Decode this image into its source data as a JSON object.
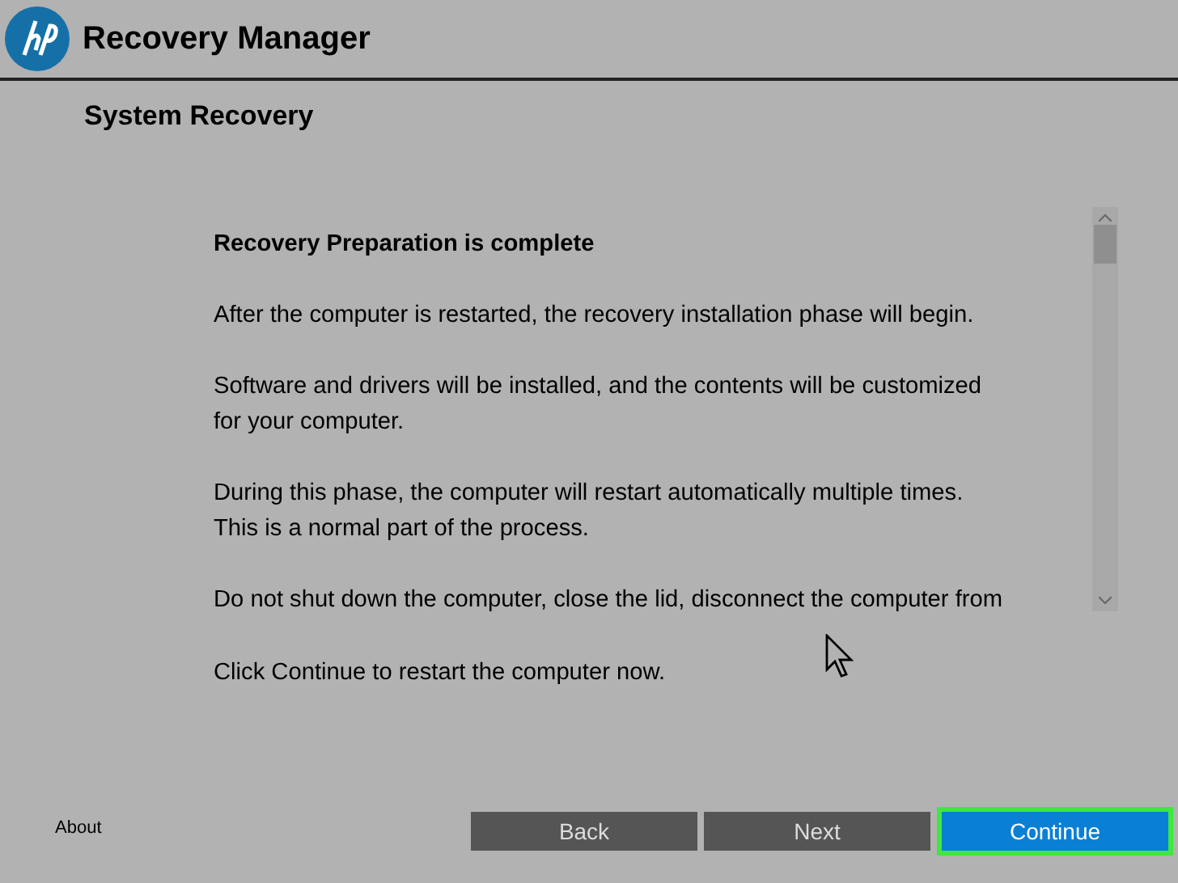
{
  "window": {
    "title": "Recovery Manager"
  },
  "section_title": "System Recovery",
  "message": {
    "heading": "Recovery Preparation is complete",
    "paragraphs": [
      "After the computer is restarted, the recovery installation phase will begin.",
      "Software and drivers will be installed, and the contents will be customized\nfor your computer.",
      "During this phase, the computer will restart automatically multiple times.\nThis is a normal part of the process.",
      "Do not shut down the computer, close the lid, disconnect the computer from"
    ]
  },
  "instruction": "Click Continue to restart the computer now.",
  "about_link": "About",
  "buttons": [
    {
      "label": "Back",
      "kind": "secondary",
      "highlighted": false
    },
    {
      "label": "Next",
      "kind": "secondary",
      "highlighted": false
    },
    {
      "label": "Continue",
      "kind": "primary",
      "highlighted": true
    }
  ]
}
